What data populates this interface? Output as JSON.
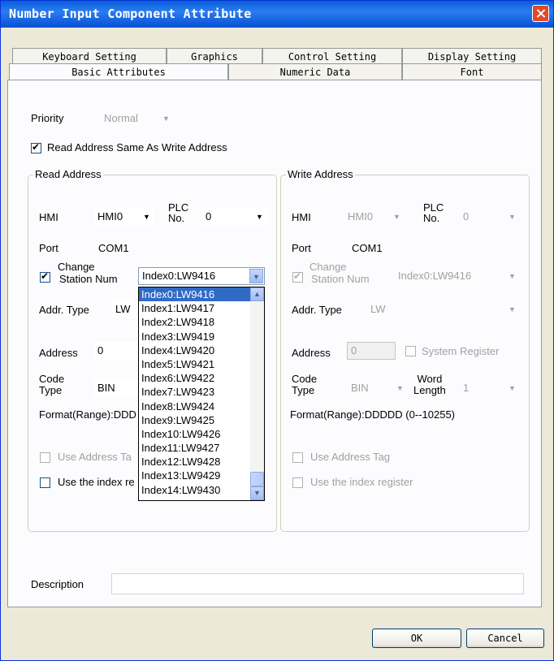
{
  "window": {
    "title": "Number Input Component Attribute"
  },
  "tabs": {
    "row1": [
      "Keyboard Setting",
      "Graphics",
      "Control Setting",
      "Display Setting"
    ],
    "row2": [
      "Basic Attributes",
      "Numeric Data",
      "Font"
    ]
  },
  "priority": {
    "label": "Priority",
    "value": "Normal"
  },
  "same_address": {
    "label": "Read Address Same As Write Address",
    "checked": true
  },
  "read": {
    "legend": "Read Address",
    "hmi_label": "HMI",
    "hmi_value": "HMI0",
    "plc_label_1": "PLC",
    "plc_label_2": "No.",
    "plc_value": "0",
    "port_label": "Port",
    "port_value": "COM1",
    "change_label_1": "Change",
    "change_label_2": "Station Num",
    "station_value": "Index0:LW9416",
    "addr_type_label": "Addr. Type",
    "addr_type_value": "LW",
    "address_label": "Address",
    "address_value": "0",
    "code_label_1": "Code",
    "code_label_2": "Type",
    "code_value": "BIN",
    "format_text": "Format(Range):DDD",
    "use_tag": "Use Address Ta",
    "use_index": "Use the index re"
  },
  "write": {
    "legend": "Write Address",
    "hmi_label": "HMI",
    "hmi_value": "HMI0",
    "plc_label_1": "PLC",
    "plc_label_2": "No.",
    "plc_value": "0",
    "port_label": "Port",
    "port_value": "COM1",
    "change_label_1": "Change",
    "change_label_2": "Station Num",
    "station_value": "Index0:LW9416",
    "addr_type_label": "Addr. Type",
    "addr_type_value": "LW",
    "address_label": "Address",
    "address_value": "0",
    "system_register": "System Register",
    "code_label_1": "Code",
    "code_label_2": "Type",
    "code_value": "BIN",
    "word_label_1": "Word",
    "word_label_2": "Length",
    "word_value": "1",
    "format_text": "Format(Range):DDDDD (0--10255)",
    "use_tag": "Use Address Tag",
    "use_index": "Use the index register"
  },
  "dropdown_items": [
    "Index0:LW9416",
    "Index1:LW9417",
    "Index2:LW9418",
    "Index3:LW9419",
    "Index4:LW9420",
    "Index5:LW9421",
    "Index6:LW9422",
    "Index7:LW9423",
    "Index8:LW9424",
    "Index9:LW9425",
    "Index10:LW9426",
    "Index11:LW9427",
    "Index12:LW9428",
    "Index13:LW9429",
    "Index14:LW9430"
  ],
  "description": {
    "label": "Description",
    "value": ""
  },
  "buttons": {
    "ok": "OK",
    "cancel": "Cancel"
  },
  "colors": {
    "title_bar": "#0a5fd8",
    "selection": "#316ac5",
    "close": "#e04a2a"
  }
}
